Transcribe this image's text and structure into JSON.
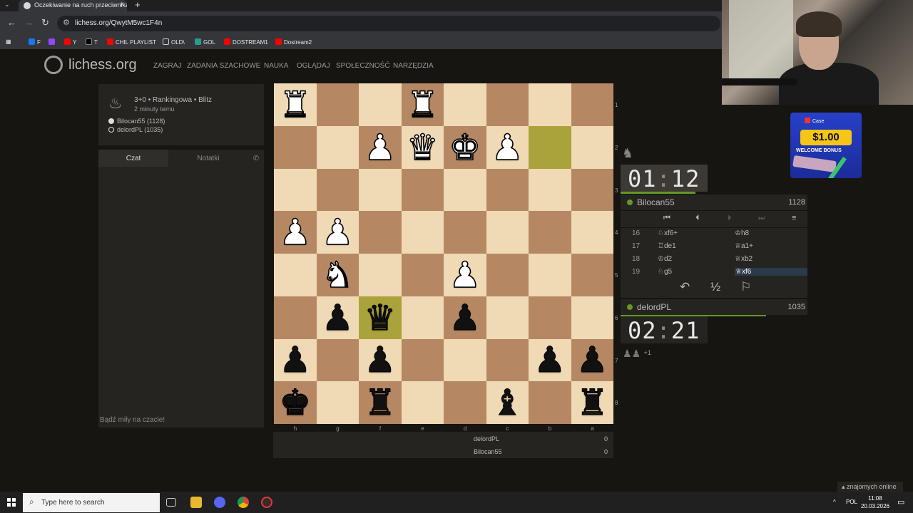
{
  "browser": {
    "tab_title": "Oczekiwanie na ruch przeciwnika",
    "new_tab_icon": "+",
    "url": "lichess.org/QwytM5wc1F4n",
    "bookmarks": [
      "F",
      "Y",
      "T",
      "CHIL PLAYLIST",
      "OLD\\",
      "GOL",
      "DOSTREAM1",
      "Dostream2"
    ]
  },
  "site": {
    "logo": "lichess.org",
    "nav": [
      "ZAGRAJ",
      "ZADANIA SZACHOWE",
      "NAUKA",
      "OGLĄDAJ",
      "SPOŁECZNOŚĆ",
      "NARZĘDZIA"
    ]
  },
  "game_info": {
    "mode": "3+0 • Rankingowa • Blitz",
    "time_ago": "2 minuty temu",
    "white_player": "Bilocan55 (1128)",
    "black_player": "delordPL (1035)"
  },
  "chat": {
    "tab_chat": "Czat",
    "tab_notes": "Notatki",
    "placeholder": "Bądź miły na czacie!"
  },
  "board": {
    "rows": [
      [
        "wR",
        "",
        "",
        "wR",
        "",
        "",
        "",
        ""
      ],
      [
        "",
        "",
        "wP",
        "wQ",
        "wK",
        "wP",
        "",
        ""
      ],
      [
        "",
        "",
        "",
        "",
        "",
        "",
        "",
        ""
      ],
      [
        "wP",
        "wP",
        "",
        "",
        "",
        "",
        "",
        ""
      ],
      [
        "",
        "wN",
        "",
        "",
        "wP",
        "",
        "",
        ""
      ],
      [
        "",
        "bP",
        "bQ",
        "",
        "bP",
        "",
        "",
        ""
      ],
      [
        "bP",
        "",
        "bP",
        "",
        "",
        "",
        "bP",
        "bP"
      ],
      [
        "bK",
        "",
        "bR",
        "",
        "",
        "bB",
        "",
        "bR"
      ]
    ],
    "highlights": [
      [
        1,
        6
      ],
      [
        5,
        2
      ]
    ],
    "files": [
      "h",
      "g",
      "f",
      "e",
      "d",
      "c",
      "b",
      "a"
    ],
    "ranks": [
      "1",
      "2",
      "3",
      "4",
      "5",
      "6",
      "7",
      "8"
    ]
  },
  "scores": [
    {
      "name": "delordPL",
      "score": "0"
    },
    {
      "name": "Bilocan55",
      "score": "0"
    }
  ],
  "opponent": {
    "clock_min": "01",
    "clock_sec": "12",
    "name": "Bilocan55",
    "rating": "1128",
    "clock_fraction": 0.4
  },
  "player": {
    "clock_min": "02",
    "clock_sec": "21",
    "name": "delordPL",
    "rating": "1035",
    "clock_fraction": 0.78,
    "captured_extra": "+1"
  },
  "moves": [
    {
      "n": "16",
      "w": "♘xf6+",
      "b": "♔h8"
    },
    {
      "n": "17",
      "w": "♖de1",
      "b": "♕a1+"
    },
    {
      "n": "18",
      "w": "♔d2",
      "b": "♕xb2"
    },
    {
      "n": "19",
      "w": "♘g5",
      "b": "♕xf6"
    }
  ],
  "ad": {
    "brand": "Case",
    "amount": "$1.00",
    "text": "WELCOME BONUS"
  },
  "friends_online": "znajomych online",
  "taskbar": {
    "search_placeholder": "Type here to search",
    "lang": "POL",
    "time": "11:08",
    "date": "20.03.2026"
  }
}
